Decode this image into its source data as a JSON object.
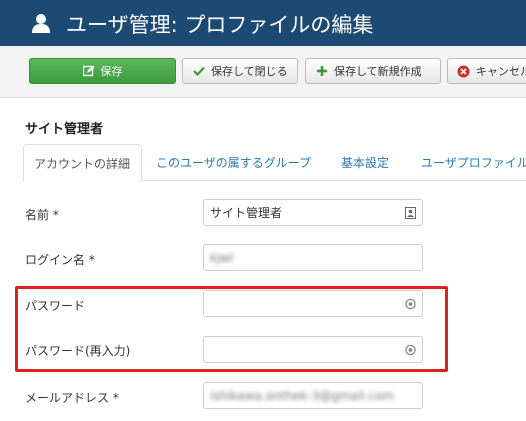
{
  "header": {
    "title": "ユーザ管理: プロファイルの編集",
    "icon": "user-icon",
    "background": "#1c4a73"
  },
  "toolbar": {
    "save_label": "保存",
    "save_close_label": "保存して閉じる",
    "save_new_label": "保存して新規作成",
    "cancel_label": "キャンセル",
    "save_color": "#46a546"
  },
  "section": {
    "title": "サイト管理者"
  },
  "tabs": [
    {
      "label": "アカウントの詳細",
      "active": true
    },
    {
      "label": "このユーザの属するグループ",
      "active": false
    },
    {
      "label": "基本設定",
      "active": false
    },
    {
      "label": "ユーザプロファイル",
      "active": false
    }
  ],
  "fields": {
    "name": {
      "label": "名前 *",
      "value": "サイト管理者"
    },
    "login": {
      "label": "ログイン名 *",
      "value": "kjwl"
    },
    "password": {
      "label": "パスワード",
      "value": ""
    },
    "password2": {
      "label": "パスワード(再入力)",
      "value": ""
    },
    "email": {
      "label": "メールアドレス *",
      "value": "ishikawa.onthek-3@gmail.com"
    }
  },
  "highlight_color": "#e02020"
}
